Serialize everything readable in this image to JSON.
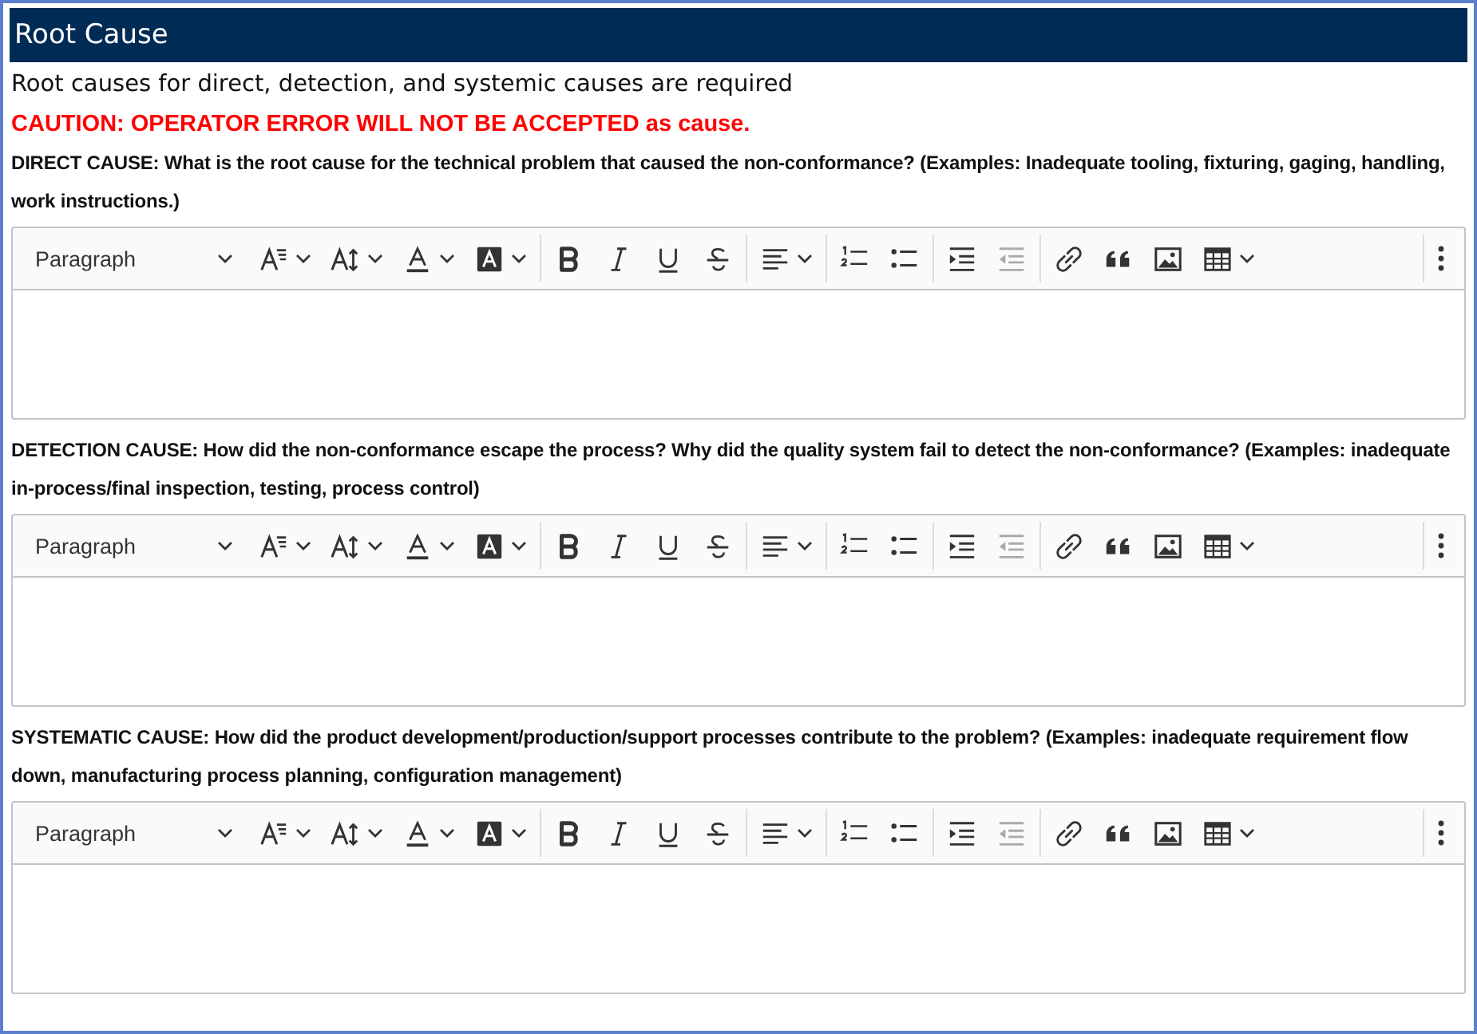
{
  "title": "Root Cause",
  "intro": "Root causes for direct, detection, and systemic causes are required",
  "caution": "CAUTION: OPERATOR ERROR WILL NOT BE ACCEPTED as cause.",
  "sections": [
    {
      "label": "DIRECT CAUSE: What is the root cause for the technical problem that caused the non-conformance? (Examples: Inadequate tooling, fixturing, gaging, handling, work instructions.)",
      "editor": {
        "heading_style": "Paragraph",
        "tools": [
          {
            "kind": "font-size",
            "dropdown": true,
            "disabled": false
          },
          {
            "kind": "line-height",
            "dropdown": true,
            "disabled": false
          },
          {
            "kind": "font-color",
            "dropdown": true,
            "disabled": false
          },
          {
            "kind": "highlight",
            "dropdown": true,
            "disabled": false
          },
          {
            "kind": "separator"
          },
          {
            "kind": "bold",
            "dropdown": false,
            "disabled": false
          },
          {
            "kind": "italic",
            "dropdown": false,
            "disabled": false
          },
          {
            "kind": "underline",
            "dropdown": false,
            "disabled": false
          },
          {
            "kind": "strikethrough",
            "dropdown": false,
            "disabled": false
          },
          {
            "kind": "separator"
          },
          {
            "kind": "align",
            "dropdown": true,
            "disabled": false
          },
          {
            "kind": "separator"
          },
          {
            "kind": "numbered-list",
            "dropdown": false,
            "disabled": false
          },
          {
            "kind": "bulleted-list",
            "dropdown": false,
            "disabled": false
          },
          {
            "kind": "separator"
          },
          {
            "kind": "indent",
            "dropdown": false,
            "disabled": false
          },
          {
            "kind": "outdent",
            "dropdown": false,
            "disabled": true
          },
          {
            "kind": "separator"
          },
          {
            "kind": "link",
            "dropdown": false,
            "disabled": false
          },
          {
            "kind": "quote",
            "dropdown": false,
            "disabled": false
          },
          {
            "kind": "image",
            "dropdown": false,
            "disabled": false
          },
          {
            "kind": "table",
            "dropdown": true,
            "disabled": false
          },
          {
            "kind": "spacer"
          },
          {
            "kind": "separator"
          },
          {
            "kind": "more",
            "dropdown": false,
            "disabled": false
          }
        ]
      }
    },
    {
      "label": "DETECTION CAUSE: How did the non-conformance escape the process? Why did the quality system fail to detect the non-conformance? (Examples: inadequate in-process/final inspection, testing, process control)",
      "editor": {
        "heading_style": "Paragraph",
        "tools": [
          {
            "kind": "font-size",
            "dropdown": true,
            "disabled": false
          },
          {
            "kind": "line-height",
            "dropdown": true,
            "disabled": false
          },
          {
            "kind": "font-color",
            "dropdown": true,
            "disabled": false
          },
          {
            "kind": "highlight",
            "dropdown": true,
            "disabled": false
          },
          {
            "kind": "separator"
          },
          {
            "kind": "bold",
            "dropdown": false,
            "disabled": false
          },
          {
            "kind": "italic",
            "dropdown": false,
            "disabled": false
          },
          {
            "kind": "underline",
            "dropdown": false,
            "disabled": false
          },
          {
            "kind": "strikethrough",
            "dropdown": false,
            "disabled": false
          },
          {
            "kind": "separator"
          },
          {
            "kind": "align",
            "dropdown": true,
            "disabled": false
          },
          {
            "kind": "separator"
          },
          {
            "kind": "numbered-list",
            "dropdown": false,
            "disabled": false
          },
          {
            "kind": "bulleted-list",
            "dropdown": false,
            "disabled": false
          },
          {
            "kind": "separator"
          },
          {
            "kind": "indent",
            "dropdown": false,
            "disabled": false
          },
          {
            "kind": "outdent",
            "dropdown": false,
            "disabled": true
          },
          {
            "kind": "separator"
          },
          {
            "kind": "link",
            "dropdown": false,
            "disabled": false
          },
          {
            "kind": "quote",
            "dropdown": false,
            "disabled": false
          },
          {
            "kind": "image",
            "dropdown": false,
            "disabled": false
          },
          {
            "kind": "table",
            "dropdown": true,
            "disabled": false
          },
          {
            "kind": "spacer"
          },
          {
            "kind": "separator"
          },
          {
            "kind": "more",
            "dropdown": false,
            "disabled": false
          }
        ]
      }
    },
    {
      "label": "SYSTEMATIC CAUSE: How did the product development/production/support processes contribute to the problem? (Examples: inadequate requirement flow down, manufacturing process planning, configuration management)",
      "editor": {
        "heading_style": "Paragraph",
        "tools": [
          {
            "kind": "font-size",
            "dropdown": true,
            "disabled": false
          },
          {
            "kind": "line-height",
            "dropdown": true,
            "disabled": false
          },
          {
            "kind": "font-color",
            "dropdown": true,
            "disabled": false
          },
          {
            "kind": "highlight",
            "dropdown": true,
            "disabled": false
          },
          {
            "kind": "separator"
          },
          {
            "kind": "bold",
            "dropdown": false,
            "disabled": false
          },
          {
            "kind": "italic",
            "dropdown": false,
            "disabled": false
          },
          {
            "kind": "underline",
            "dropdown": false,
            "disabled": false
          },
          {
            "kind": "strikethrough",
            "dropdown": false,
            "disabled": false
          },
          {
            "kind": "separator"
          },
          {
            "kind": "align",
            "dropdown": true,
            "disabled": false
          },
          {
            "kind": "separator"
          },
          {
            "kind": "numbered-list",
            "dropdown": false,
            "disabled": false
          },
          {
            "kind": "bulleted-list",
            "dropdown": false,
            "disabled": false
          },
          {
            "kind": "separator"
          },
          {
            "kind": "indent",
            "dropdown": false,
            "disabled": false
          },
          {
            "kind": "outdent",
            "dropdown": false,
            "disabled": true
          },
          {
            "kind": "separator"
          },
          {
            "kind": "link",
            "dropdown": false,
            "disabled": false
          },
          {
            "kind": "quote",
            "dropdown": false,
            "disabled": false
          },
          {
            "kind": "image",
            "dropdown": false,
            "disabled": false
          },
          {
            "kind": "table",
            "dropdown": true,
            "disabled": false
          },
          {
            "kind": "spacer"
          },
          {
            "kind": "separator"
          },
          {
            "kind": "more",
            "dropdown": false,
            "disabled": false
          }
        ]
      }
    }
  ]
}
